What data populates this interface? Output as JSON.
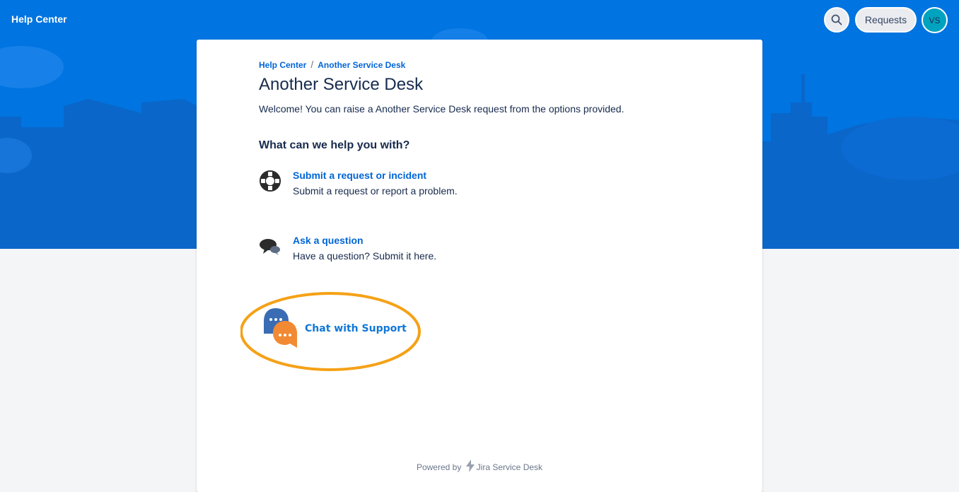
{
  "header": {
    "brand": "Help Center",
    "requests_label": "Requests",
    "avatar_initials": "VS"
  },
  "breadcrumb": {
    "items": [
      "Help Center",
      "Another Service Desk"
    ],
    "separator": "/"
  },
  "page": {
    "title": "Another Service Desk",
    "welcome": "Welcome! You can raise a Another Service Desk request from the options provided.",
    "help_heading": "What can we help you with?"
  },
  "options": [
    {
      "name": "Submit a request or incident",
      "description": "Submit a request or report a problem.",
      "icon": "lifebuoy-icon"
    },
    {
      "name": "Ask a question",
      "description": "Have a question? Submit it here.",
      "icon": "speech-bubbles-icon"
    }
  ],
  "chat": {
    "label": "Chat with Support",
    "icon": "chat-bubbles-icon"
  },
  "footer": {
    "powered_by": "Powered by",
    "product": "Jira Service Desk"
  },
  "colors": {
    "banner": "#0074e0",
    "link": "#0065d6",
    "highlight_ring": "#f5a116",
    "avatar": "#00a3bf"
  }
}
